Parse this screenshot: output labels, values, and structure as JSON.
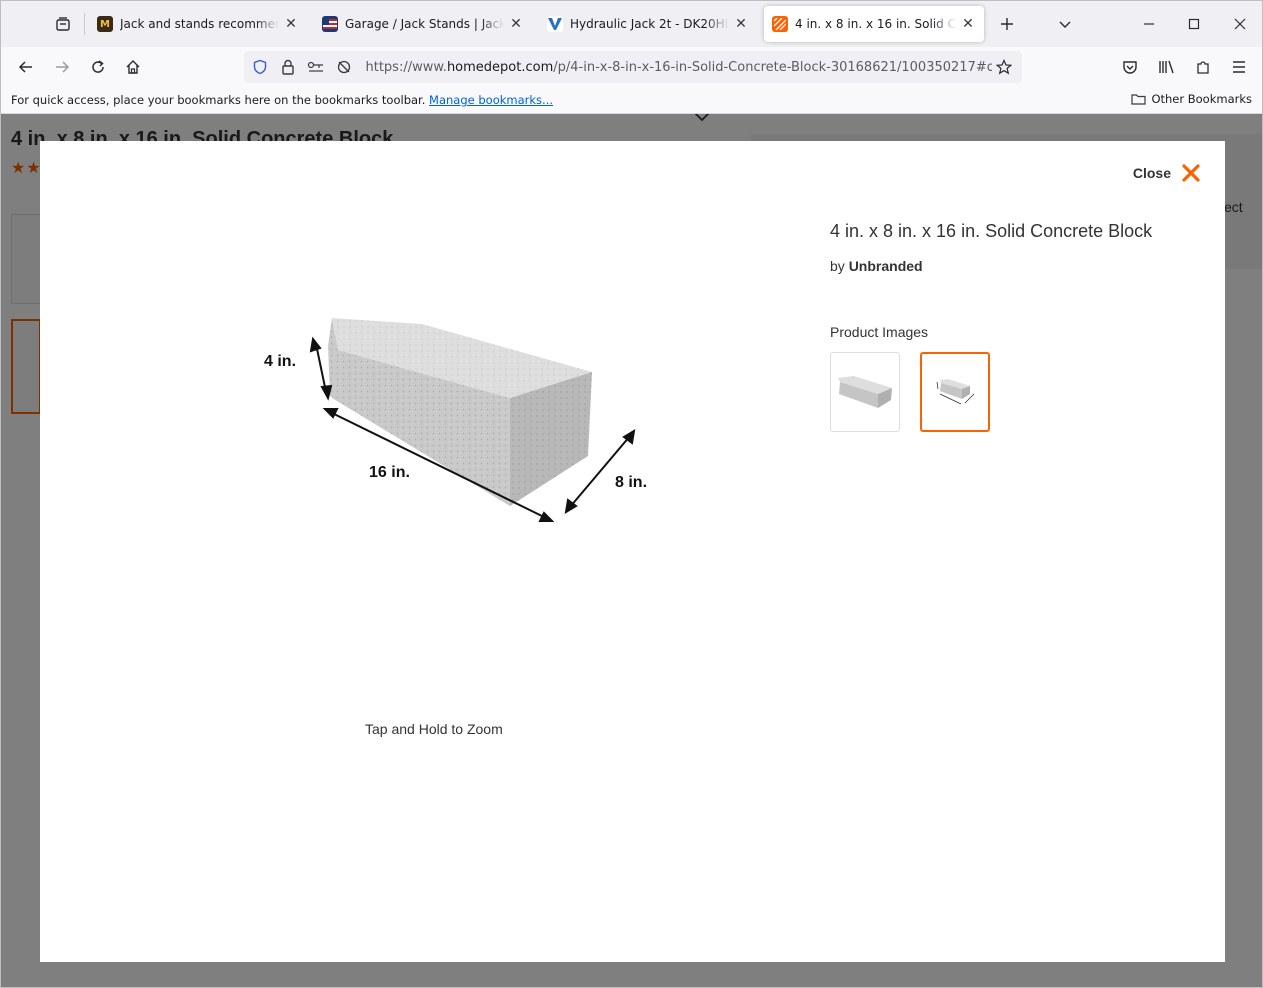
{
  "browser": {
    "tabs": [
      {
        "title": "Jack and stands recommendatio",
        "favicon": "m-favicon",
        "active": false
      },
      {
        "title": "Garage / Jack Stands | Jack Stan",
        "favicon": "flag-favicon",
        "active": false
      },
      {
        "title": "Hydraulic Jack 2t - DK20HLQ",
        "favicon": "vp-favicon",
        "active": false
      },
      {
        "title": "4 in. x 8 in. x 16 in. Solid Concre",
        "favicon": "homedepot-favicon",
        "active": true
      }
    ],
    "url_prefix": "https://www.",
    "url_host": "homedepot.com",
    "url_path": "/p/4-in-x-8-in-x-16-in-Solid-Concrete-Block-30168621/100350217#overla",
    "bookmarks_hint": "For quick access, place your bookmarks here on the bookmarks toolbar.",
    "bookmarks_link": "Manage bookmarks...",
    "other_bookmarks": "Other Bookmarks"
  },
  "background_page": {
    "title": "4 in. x 8 in. x 16 in. Solid Concrete Block",
    "stars": "★★",
    "right_text": "ect"
  },
  "modal": {
    "close_label": "Close",
    "product_title": "4 in. x 8 in. x 16 in. Solid Concrete Block",
    "by": "by",
    "brand": "Unbranded",
    "images_heading": "Product Images",
    "zoom_hint": "Tap and Hold to Zoom",
    "dimensions": {
      "height": "4 in.",
      "length": "16 in.",
      "width": "8 in."
    },
    "thumbnails": [
      {
        "name": "block-photo",
        "selected": false
      },
      {
        "name": "block-dimensions",
        "selected": true
      }
    ]
  },
  "colors": {
    "accent": "#f96302"
  }
}
